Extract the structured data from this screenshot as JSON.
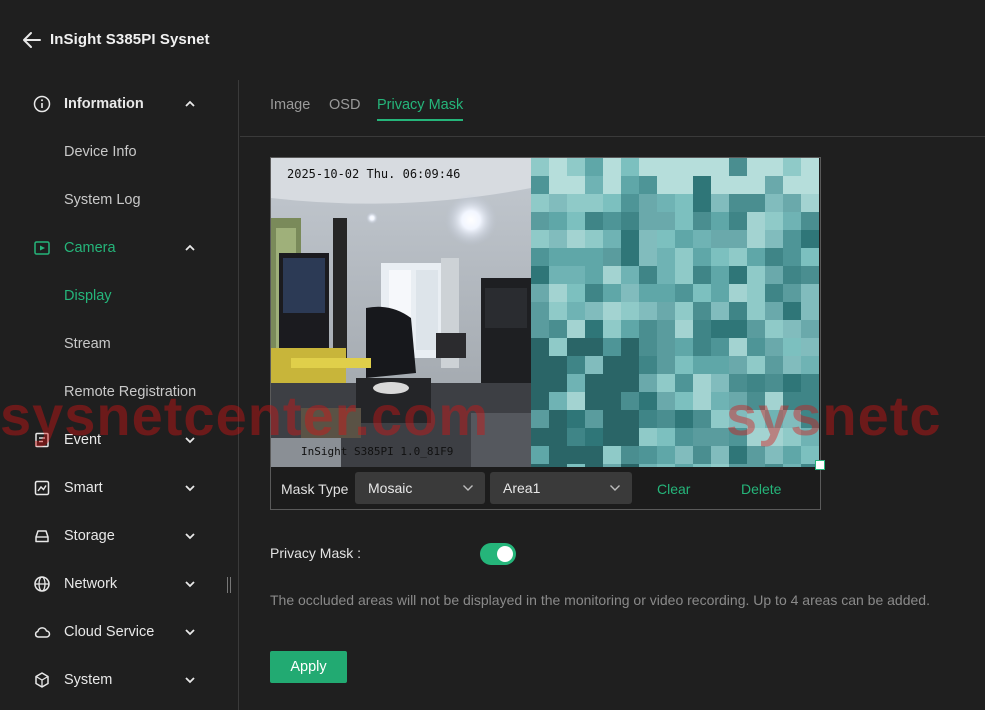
{
  "header": {
    "title": "InSight S385PI Sysnet"
  },
  "sidebar": {
    "items": [
      {
        "label": "Information",
        "icon": "info-icon",
        "expanded": true
      },
      {
        "label": "Device Info"
      },
      {
        "label": "System Log"
      },
      {
        "label": "Camera",
        "icon": "camera-icon",
        "expanded": true
      },
      {
        "label": "Display"
      },
      {
        "label": "Stream"
      },
      {
        "label": "Remote Registration"
      },
      {
        "label": "Event",
        "icon": "event-icon"
      },
      {
        "label": "Smart",
        "icon": "smart-icon"
      },
      {
        "label": "Storage",
        "icon": "storage-icon"
      },
      {
        "label": "Network",
        "icon": "globe-icon"
      },
      {
        "label": "Cloud Service",
        "icon": "cloud-icon"
      },
      {
        "label": "System",
        "icon": "system-icon"
      }
    ]
  },
  "tabs": [
    {
      "label": "Image"
    },
    {
      "label": "OSD"
    },
    {
      "label": "Privacy Mask",
      "active": true
    }
  ],
  "preview": {
    "timestamp": "2025-10-02 Thu. 06:09:46",
    "camera_name": "InSight S385PI 1.0_81F9"
  },
  "controls": {
    "mask_type_label": "Mask Type",
    "mask_type_value": "Mosaic",
    "area_value": "Area1",
    "clear_label": "Clear",
    "delete_label": "Delete"
  },
  "privacy_mask": {
    "label": "Privacy Mask :",
    "enabled": true,
    "hint": "The occluded areas will not be displayed in the monitoring or video recording. Up to 4 areas can be added."
  },
  "apply_label": "Apply",
  "watermark": {
    "left": "sysnetcenter.com",
    "right": "sysnetc"
  },
  "colors": {
    "accent": "#25b57a",
    "background": "#1f1f1f",
    "text": "#e6e6e6",
    "muted": "#8a8a8a",
    "watermark": "#d71414"
  }
}
